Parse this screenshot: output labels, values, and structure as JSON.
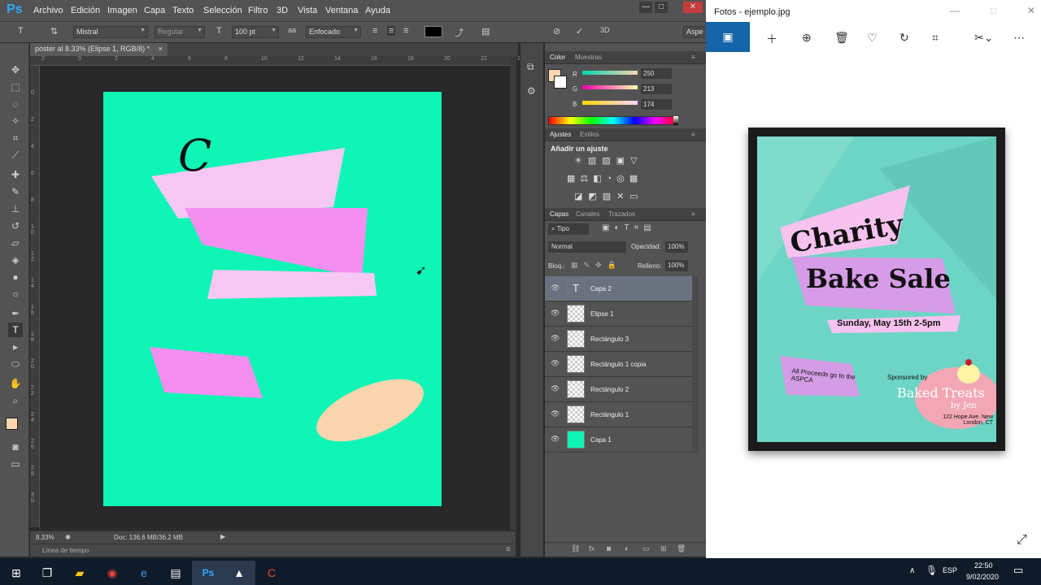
{
  "photoshop": {
    "logo": "Ps",
    "menu": [
      "Archivo",
      "Edición",
      "Imagen",
      "Capa",
      "Texto",
      "Selección",
      "Filtro",
      "3D",
      "Vista",
      "Ventana",
      "Ayuda"
    ],
    "window_controls": [
      "—",
      "□",
      "✕"
    ],
    "options": {
      "font_family": "Mistral",
      "font_style": "Regular",
      "font_size": "100 pt",
      "antialias_icon": "aa",
      "antialias": "Enfocado",
      "workspace": "Aspe"
    },
    "document": {
      "tab_title": "poster al 8.33% (Elipse 1, RGB/8) *",
      "tab_close": "×",
      "zoom": "8.33%",
      "doc_info": "Doc: 136.6 MB/36.2 MB",
      "timeline_label": "Línea de tiempo",
      "canvas_text": "C",
      "ruler_top": [
        "2",
        "0",
        "2",
        "4",
        "6",
        "8",
        "10",
        "12",
        "14",
        "16",
        "18",
        "20",
        "22",
        "24"
      ],
      "ruler_left": [
        "0",
        "2",
        "4",
        "6",
        "8",
        "1\n0",
        "1\n2",
        "1\n4",
        "1\n6",
        "1\n8",
        "2\n0",
        "2\n2",
        "2\n4",
        "2\n6",
        "2\n8",
        "3\n0"
      ]
    },
    "color_panel": {
      "tabs": [
        "Color",
        "Muestras"
      ],
      "foreground": "#fad5ae",
      "channels": [
        {
          "label": "R",
          "value": "250"
        },
        {
          "label": "G",
          "value": "213"
        },
        {
          "label": "B",
          "value": "174"
        }
      ]
    },
    "adjustments_panel": {
      "tabs": [
        "Ajustes",
        "Estilos"
      ],
      "heading": "Añadir un ajuste"
    },
    "layers_panel": {
      "tabs": [
        "Capas",
        "Canales",
        "Trazados"
      ],
      "filter": "Tipo",
      "blend_mode": "Normal",
      "opacity_label": "Opacidad:",
      "opacity": "100%",
      "lock_label": "Bloq.:",
      "fill_label": "Relleno:",
      "fill": "100%",
      "layers": [
        {
          "name": "Capa 2",
          "kind": "text",
          "selected": true
        },
        {
          "name": "Elipse 1",
          "kind": "pixel",
          "selected": false
        },
        {
          "name": "Rectángulo 3",
          "kind": "pixel",
          "selected": false
        },
        {
          "name": "Rectángulo 1 copia",
          "kind": "pixel",
          "selected": false
        },
        {
          "name": "Rectángulo 2",
          "kind": "pixel",
          "selected": false
        },
        {
          "name": "Rectángulo 1",
          "kind": "pixel",
          "selected": false
        },
        {
          "name": "Capa 1",
          "kind": "fill",
          "selected": false
        }
      ],
      "footer_icons": [
        "link-icon",
        "fx-icon",
        "mask-icon",
        "adjustment-icon",
        "folder-icon",
        "new-layer-icon",
        "trash-icon"
      ]
    }
  },
  "photos": {
    "title": "Fotos - ejemplo.jpg",
    "window_controls": [
      "—",
      "□",
      "✕"
    ],
    "toolbar": [
      "image-icon",
      "add-icon",
      "zoom-icon",
      "delete-icon",
      "heart-icon",
      "rotate-icon",
      "crop-icon",
      "edit-icon",
      "more-icon"
    ],
    "poster": {
      "line1": "Charity",
      "line2": "Bake Sale",
      "date": "Sunday, May 15th 2-5pm",
      "proceeds": "All Proceeds go to the ASPCA",
      "sponsor_label": "Sponsored by",
      "sponsor": "Baked Treats",
      "sponsor_sub": "by Jen",
      "address": "122 Hope Ave. New London, CT"
    }
  },
  "taskbar": {
    "apps": [
      "windows-icon",
      "task-view-icon",
      "file-explorer-icon",
      "chrome-icon",
      "edge-icon",
      "media-icon",
      "photoshop-icon",
      "photos-icon",
      "ccleaner-icon"
    ],
    "language": "ESP",
    "time": "22:50",
    "date": "9/02/2020"
  }
}
